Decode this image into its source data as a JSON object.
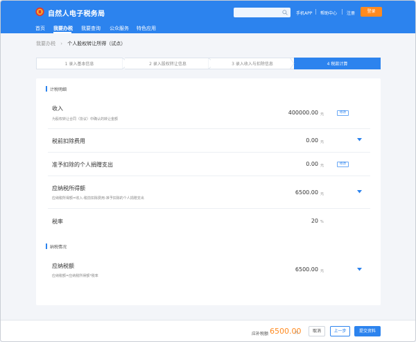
{
  "header": {
    "site_title": "自然人电子税务局",
    "links": [
      "手机APP",
      "帮助中心",
      "注册"
    ],
    "login_label": "登录"
  },
  "nav": {
    "items": [
      "首页",
      "我要办税",
      "我要查询",
      "公众服务",
      "特色应用"
    ]
  },
  "breadcrumb": {
    "parent": "我要办税",
    "current": "个人股权转让所得（试点）"
  },
  "steps": [
    {
      "label": "1  录入基本信息"
    },
    {
      "label": "2  录入股权转让信息"
    },
    {
      "label": "3  录入收入与扣除信息"
    },
    {
      "label": "4  税款计算"
    }
  ],
  "sections": {
    "calc_title": "计税明细",
    "pay_title": "纳税情况"
  },
  "rows": {
    "income": {
      "label": "收入",
      "sub": "为股权转让合同（协议）中确认的转让金额",
      "value": "400000.00",
      "unit": "元",
      "edit": "修改"
    },
    "pre_tax_deduction": {
      "label": "税前扣除费用",
      "value": "0.00",
      "unit": "元"
    },
    "donation": {
      "label": "准予扣除的个人捐赠支出",
      "value": "0.00",
      "unit": "元",
      "edit": "修改"
    },
    "taxable_income": {
      "label": "应纳税所得额",
      "sub": "应纳税所得额=收入-税前扣除费用-准予扣除的个人捐赠支出",
      "value": "6500.00",
      "unit": "元"
    },
    "tax_rate": {
      "label": "税率",
      "value": "20",
      "unit": "%"
    },
    "tax_payable": {
      "label": "应纳税额",
      "sub": "应纳税额=应纳税所得额*税率",
      "value": "6500.00",
      "unit": "元"
    }
  },
  "footer": {
    "due_label": "应补税额",
    "due_value": "6500.00",
    "due_unit": "元",
    "cancel_label": "取消",
    "prev_label": "上一步",
    "submit_label": "提交资料"
  },
  "colors": {
    "primary": "#2c83ee",
    "accent": "#ff8a1f"
  }
}
